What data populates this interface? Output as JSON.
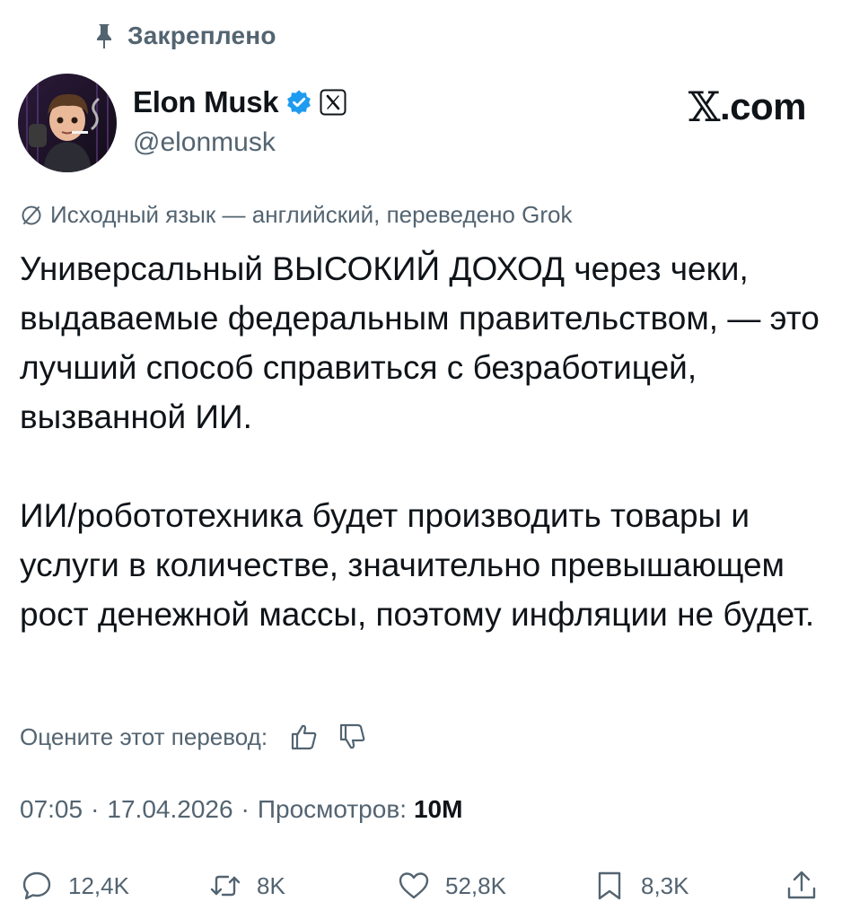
{
  "pinned": {
    "label": "Закреплено",
    "icon": "pin-icon"
  },
  "author": {
    "name": "Elon Musk",
    "handle": "@elonmusk",
    "verified_icon": "verified-badge-icon",
    "affiliation_icon": "x-affiliation-icon",
    "accent_color": "#1d9bf0"
  },
  "site_logo": {
    "symbol": "𝕏",
    "suffix": ".com"
  },
  "translation": {
    "note": "Исходный язык — английский, переведено Grok",
    "icon": "globe-icon"
  },
  "tweet": {
    "paragraph_1": "Универсальный ВЫСОКИЙ ДОХОД через чеки, выдаваемые федеральным правительством, — это лучший способ справиться с безработицей, вызванной ИИ.",
    "paragraph_2": "ИИ/робототехника будет производить товары и услуги в количестве, значительно превышающем рост денежной массы, поэтому инфляции не будет."
  },
  "rating": {
    "label": "Оцените этот перевод:",
    "like_icon": "thumbs-up-icon",
    "dislike_icon": "thumbs-down-icon"
  },
  "meta": {
    "time": "07:05",
    "date": "17.04.2026",
    "views_label": "Просмотров:",
    "views_count": "10M",
    "separator": "·"
  },
  "actions": {
    "replies": "12,4K",
    "reposts": "8K",
    "likes": "52,8K",
    "bookmarks": "8,3K"
  },
  "colors": {
    "text": "#0f1419",
    "secondary": "#536471",
    "background": "#ffffff"
  }
}
